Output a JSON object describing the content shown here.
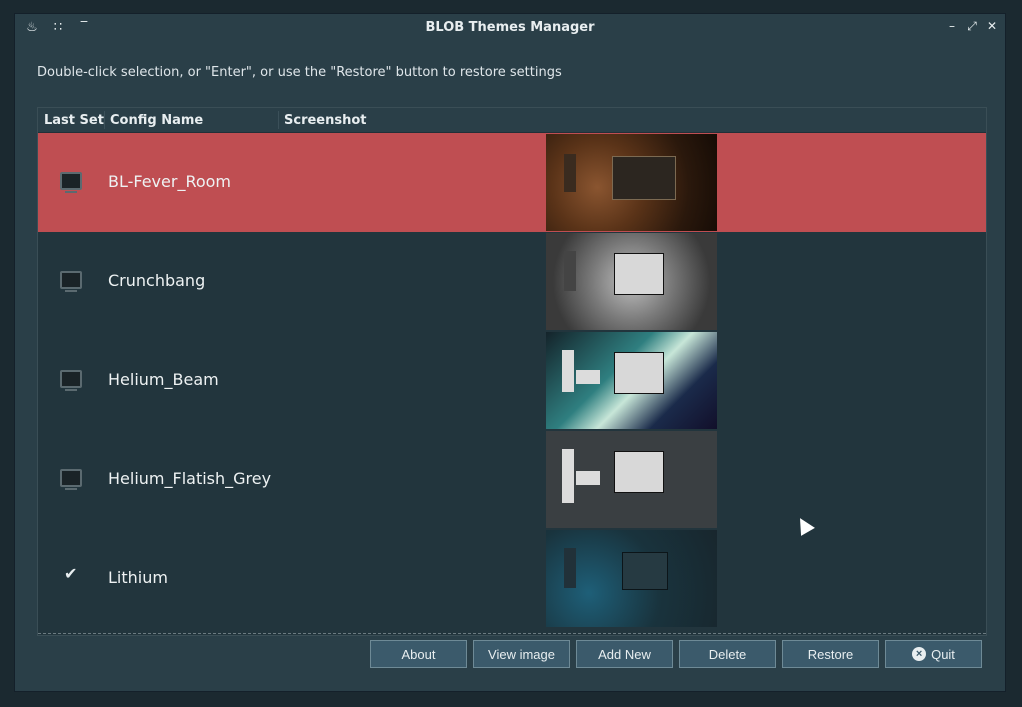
{
  "window": {
    "title": "BLOB Themes Manager",
    "left_icons": [
      "flame-icon",
      "grip-icon",
      "minimize-left-icon"
    ],
    "right_icons": [
      "minimize-icon",
      "maximize-icon",
      "close-icon"
    ]
  },
  "instructions": "Double-click selection, or \"Enter\", or use the \"Restore\" button to restore settings",
  "table": {
    "columns": [
      "Last Set",
      "Config Name",
      "Screenshot"
    ],
    "rows": [
      {
        "name": "BL-Fever_Room",
        "last_set": "monitor",
        "selected": true
      },
      {
        "name": "Crunchbang",
        "last_set": "monitor",
        "selected": false
      },
      {
        "name": "Helium_Beam",
        "last_set": "monitor",
        "selected": false
      },
      {
        "name": "Helium_Flatish_Grey",
        "last_set": "monitor",
        "selected": false
      },
      {
        "name": "Lithium",
        "last_set": "check",
        "selected": false
      }
    ]
  },
  "buttons": {
    "about": "About",
    "view_image": "View image",
    "add_new": "Add New",
    "delete": "Delete",
    "restore": "Restore",
    "quit": "Quit"
  },
  "colors": {
    "selected_row": "#bf4e52",
    "window_bg": "#2a3f48",
    "button_bg": "#3b5a6b"
  }
}
